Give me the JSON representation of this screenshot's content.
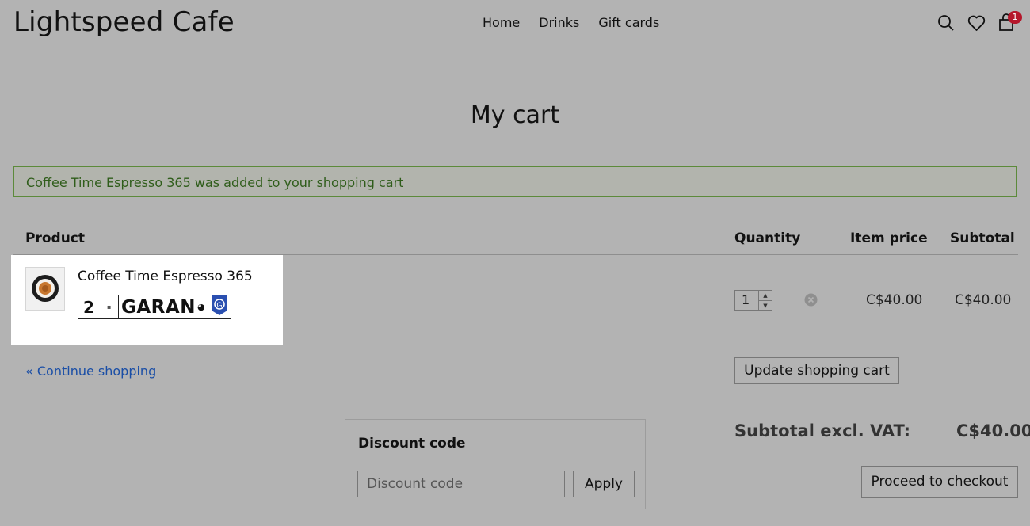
{
  "header": {
    "brand": "Lightspeed Cafe",
    "nav": [
      "Home",
      "Drinks",
      "Gift cards"
    ],
    "cart_count": "1",
    "icons": [
      "search-icon",
      "heart-icon",
      "cart-icon"
    ]
  },
  "page": {
    "title": "My cart",
    "notice": "Coffee Time Espresso 365 was added to your shopping cart"
  },
  "table": {
    "headers": {
      "product": "Product",
      "quantity": "Quantity",
      "item_price": "Item price",
      "subtotal": "Subtotal"
    },
    "rows": [
      {
        "name": "Coffee Time Espresso 365",
        "badge_number": "2",
        "badge_text": "GARAN",
        "quantity": "1",
        "item_price": "C$40.00",
        "subtotal": "C$40.00"
      }
    ]
  },
  "actions": {
    "continue_shopping": "« Continue shopping",
    "update_cart": "Update shopping cart",
    "checkout": "Proceed to checkout"
  },
  "discount": {
    "title": "Discount code",
    "placeholder": "Discount code",
    "apply": "Apply"
  },
  "totals": {
    "label": "Subtotal excl. VAT:",
    "value": "C$40.00"
  },
  "colors": {
    "background": "#b3b3b3",
    "notice_text": "#2f5d1a",
    "notice_border": "#5c8a3a",
    "link": "#1a4ea6",
    "badge": "#b5172b"
  }
}
